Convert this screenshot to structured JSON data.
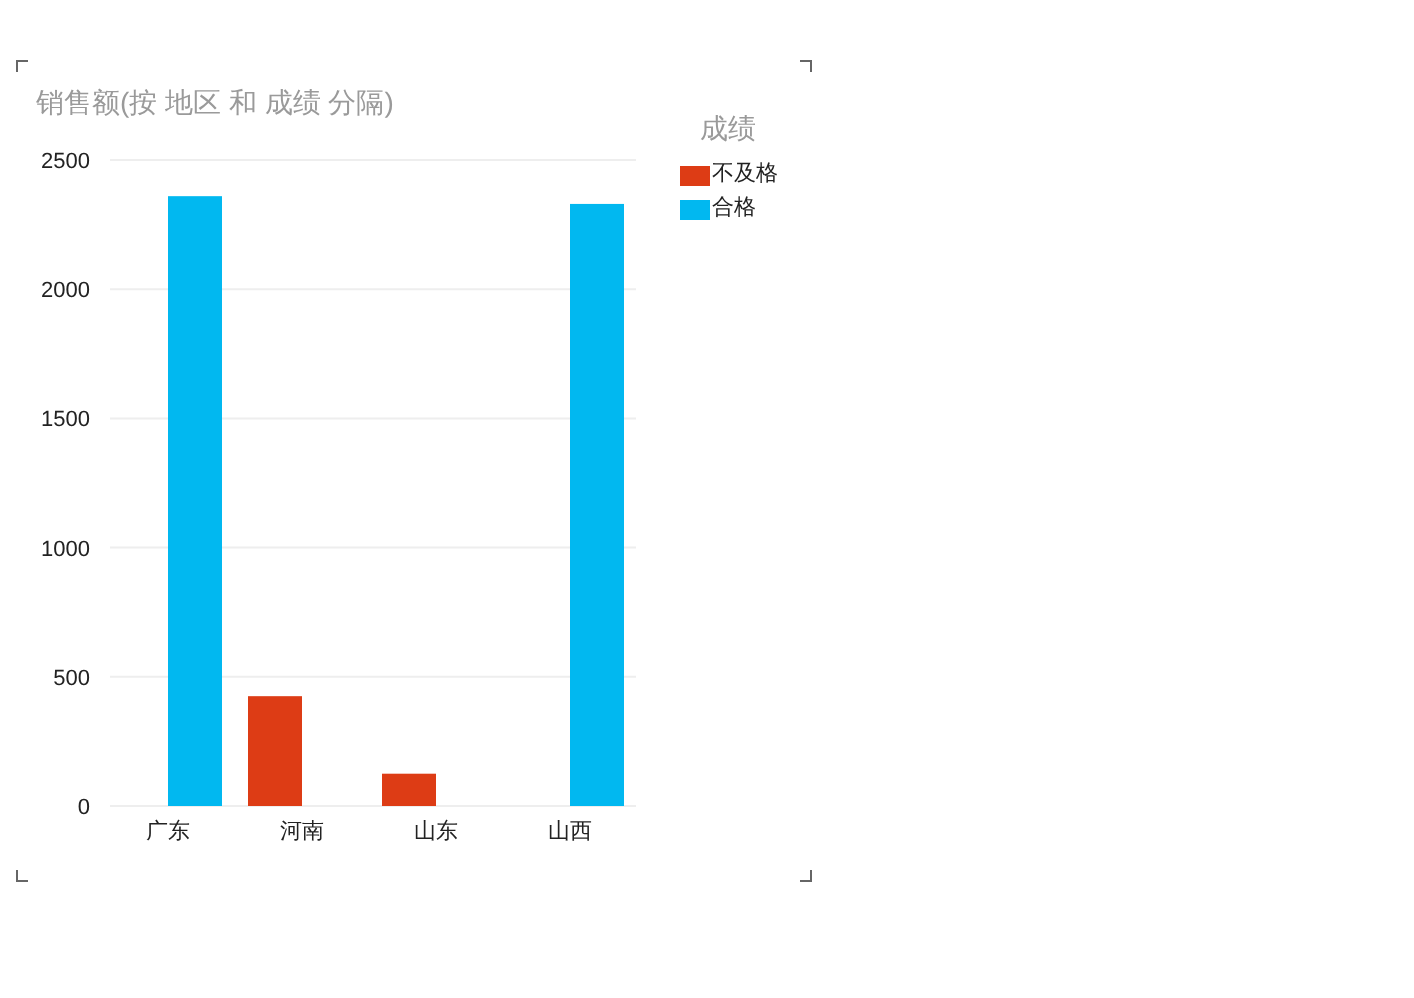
{
  "visual": {
    "title": "销售额(按 地区 和 成绩 分隔)",
    "chart_data": {
      "type": "bar",
      "categories": [
        "广东",
        "河南",
        "山东",
        "山西"
      ],
      "ylim": [
        0,
        2500
      ],
      "grid": true,
      "yticks": [
        0,
        500,
        1000,
        1500,
        2000,
        2500
      ],
      "series": [
        {
          "name": "不及格",
          "color": "#dd3c15",
          "values": [
            null,
            425,
            125,
            null
          ]
        },
        {
          "name": "合格",
          "color": "#01b8f0",
          "values": [
            2360,
            null,
            null,
            2330
          ]
        }
      ]
    },
    "legend": {
      "title": "成绩"
    }
  }
}
